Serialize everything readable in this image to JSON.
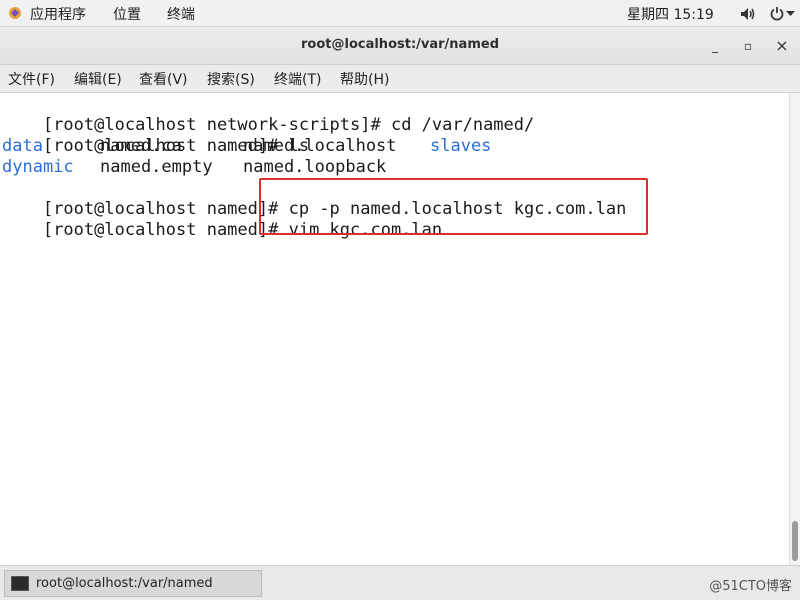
{
  "topbar": {
    "applications": "应用程序",
    "places": "位置",
    "terminal": "终端",
    "datetime": "星期四 15:19"
  },
  "window": {
    "title": "root@localhost:/var/named",
    "minimize": "_",
    "maximize": "▫",
    "close": "×"
  },
  "menubar": {
    "items": [
      "文件(F)",
      "编辑(E)",
      "查看(V)",
      "搜索(S)",
      "终端(T)",
      "帮助(H)"
    ]
  },
  "terminal": {
    "lines": [
      {
        "prompt": "[root@localhost network-scripts]#",
        "command": " cd /var/named/"
      },
      {
        "prompt": "[root@localhost named]#",
        "command": " ls"
      },
      {
        "prompt": "[root@localhost named]#",
        "command": " cp -p named.localhost kgc.com.lan"
      },
      {
        "prompt": "[root@localhost named]#",
        "command": " vim kgc.com.lan"
      }
    ],
    "ls_output": [
      [
        "data",
        "named.ca",
        "named.localhost",
        "slaves"
      ],
      [
        "dynamic",
        "named.empty",
        "named.loopback"
      ]
    ],
    "highlight_color": "#d9302c",
    "dir_color": "#2a6fd6"
  },
  "taskbar": {
    "entry_label": "root@localhost:/var/named",
    "watermark": "@51CTO博客"
  }
}
